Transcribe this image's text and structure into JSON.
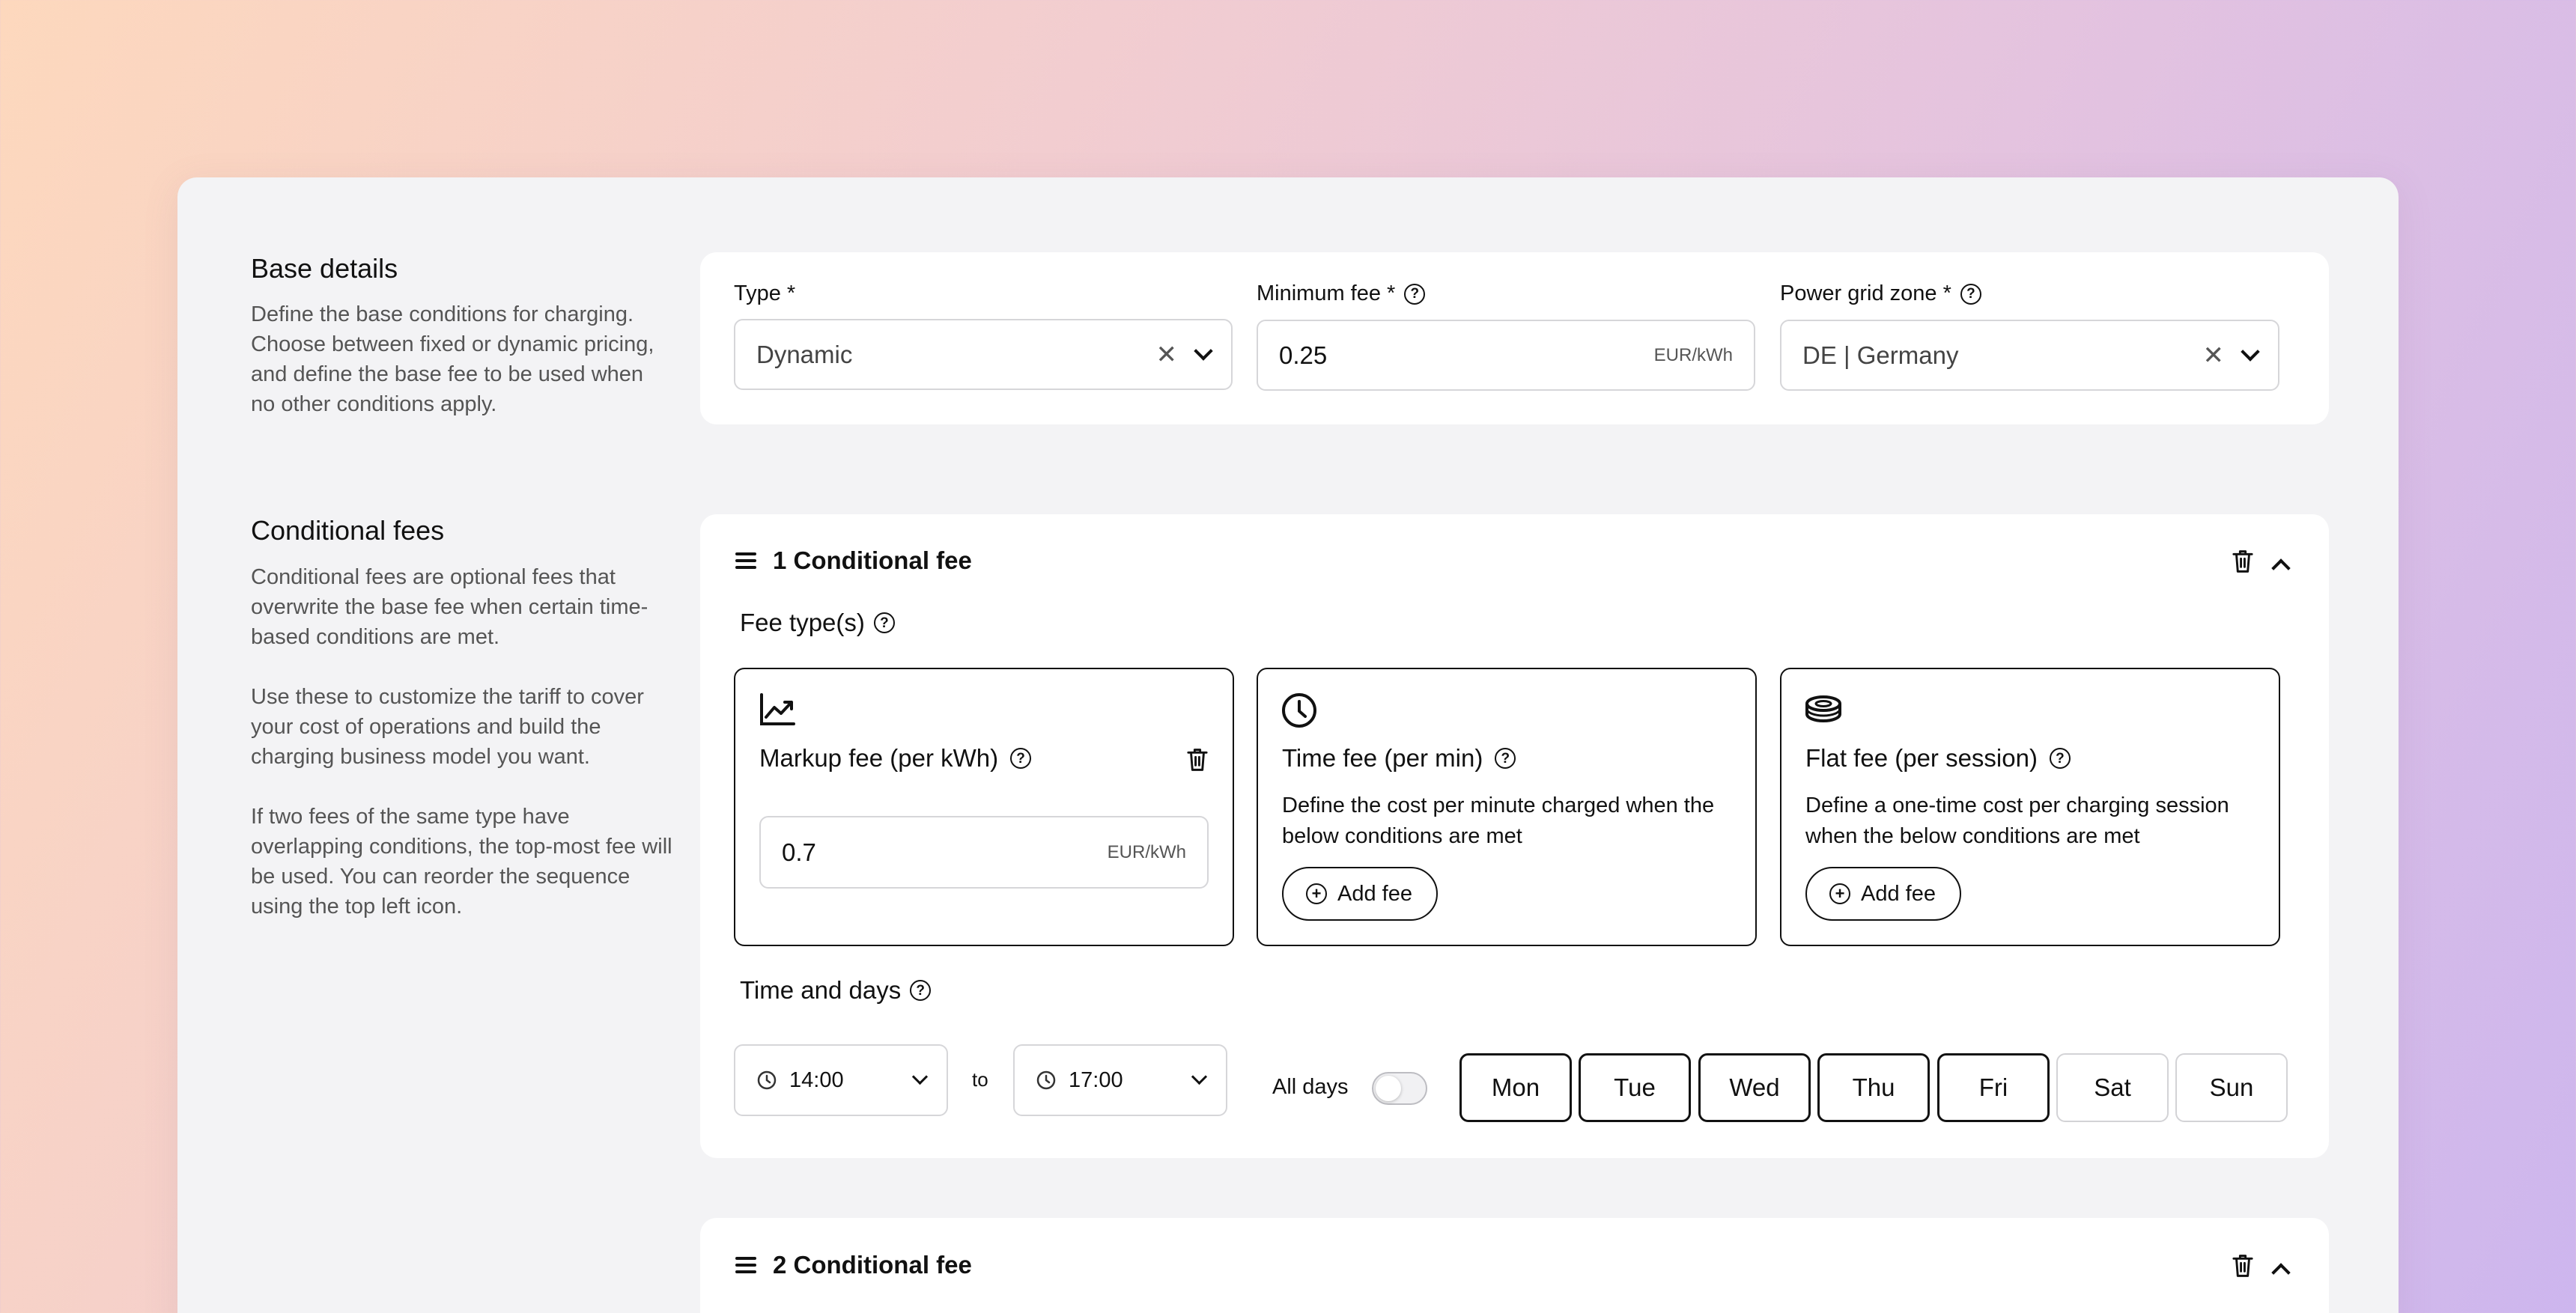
{
  "base": {
    "title": "Base details",
    "desc": "Define the base conditions for charging. Choose between fixed or dynamic pricing, and define the base fee to be used when no other conditions apply.",
    "type_label": "Type *",
    "type_value": "Dynamic",
    "min_fee_label": "Minimum fee *",
    "min_fee_value": "0.25",
    "min_fee_unit": "EUR/kWh",
    "zone_label": "Power grid zone *",
    "zone_value": "DE | Germany"
  },
  "conditional": {
    "title": "Conditional fees",
    "desc_1": "Conditional fees are optional fees that overwrite the base fee when certain time-based conditions are met.",
    "desc_2": "Use these to customize the tariff to cover your cost of operations and build the charging business model you want.",
    "desc_3": "If two fees of the same type have overlapping conditions, the top-most fee will be used. You can reorder the sequence using the top left icon."
  },
  "fee1": {
    "title": "1 Conditional fee",
    "fee_types_label": "Fee type(s)",
    "markup": {
      "title": "Markup fee (per kWh)",
      "value": "0.7",
      "unit": "EUR/kWh"
    },
    "time": {
      "title": "Time fee (per min)",
      "desc": "Define the cost per minute charged when the below conditions are met",
      "button": "Add fee"
    },
    "flat": {
      "title": "Flat fee (per session)",
      "desc": "Define a one-time cost per charging session when the below conditions are met",
      "button": "Add fee"
    },
    "time_days_label": "Time and days",
    "from": "14:00",
    "to_label": "to",
    "to": "17:00",
    "all_days_label": "All days",
    "all_days_on": false,
    "days": [
      {
        "label": "Mon",
        "selected": true
      },
      {
        "label": "Tue",
        "selected": true
      },
      {
        "label": "Wed",
        "selected": true
      },
      {
        "label": "Thu",
        "selected": true
      },
      {
        "label": "Fri",
        "selected": true
      },
      {
        "label": "Sat",
        "selected": false
      },
      {
        "label": "Sun",
        "selected": false
      }
    ]
  },
  "fee2": {
    "title": "2 Conditional fee"
  }
}
